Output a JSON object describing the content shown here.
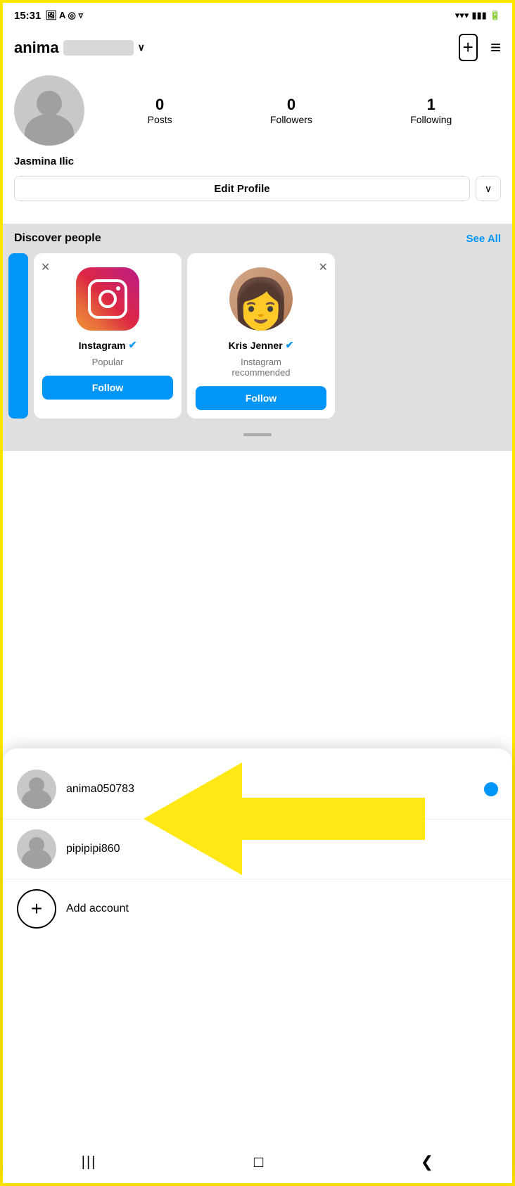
{
  "statusBar": {
    "time": "15:31",
    "icons": [
      "photo",
      "A",
      "circle"
    ]
  },
  "header": {
    "username": "anima",
    "blurredSuffix": true,
    "newPostIcon": "⊞",
    "menuIcon": "≡"
  },
  "profile": {
    "avatarAlt": "profile picture",
    "name": "Jasmina Ilic",
    "stats": {
      "posts": {
        "count": "0",
        "label": "Posts"
      },
      "followers": {
        "count": "0",
        "label": "Followers"
      },
      "following": {
        "count": "1",
        "label": "Following"
      }
    },
    "editProfileLabel": "Edit Profile",
    "dropdownChevron": "∨"
  },
  "discoverPeople": {
    "title": "Discover people",
    "seeAllLabel": "See All",
    "cards": [
      {
        "id": "instagram",
        "name": "Instagram",
        "verified": true,
        "sub": "Popular",
        "followLabel": "Follow",
        "type": "logo"
      },
      {
        "id": "kris-jenner",
        "name": "Kris Jenner",
        "verified": true,
        "sub": "Instagram\nrecommended",
        "followLabel": "Follow",
        "type": "person"
      }
    ]
  },
  "accountSwitcher": {
    "accounts": [
      {
        "username": "anima050783",
        "active": true
      },
      {
        "username": "pipipipi860",
        "active": false
      }
    ],
    "addAccountLabel": "Add account"
  },
  "bottomNav": {
    "backIcon": "❮",
    "homeIcon": "□",
    "menuIcon": "|||"
  },
  "annotation": {
    "arrowColor": "#FFE600"
  }
}
